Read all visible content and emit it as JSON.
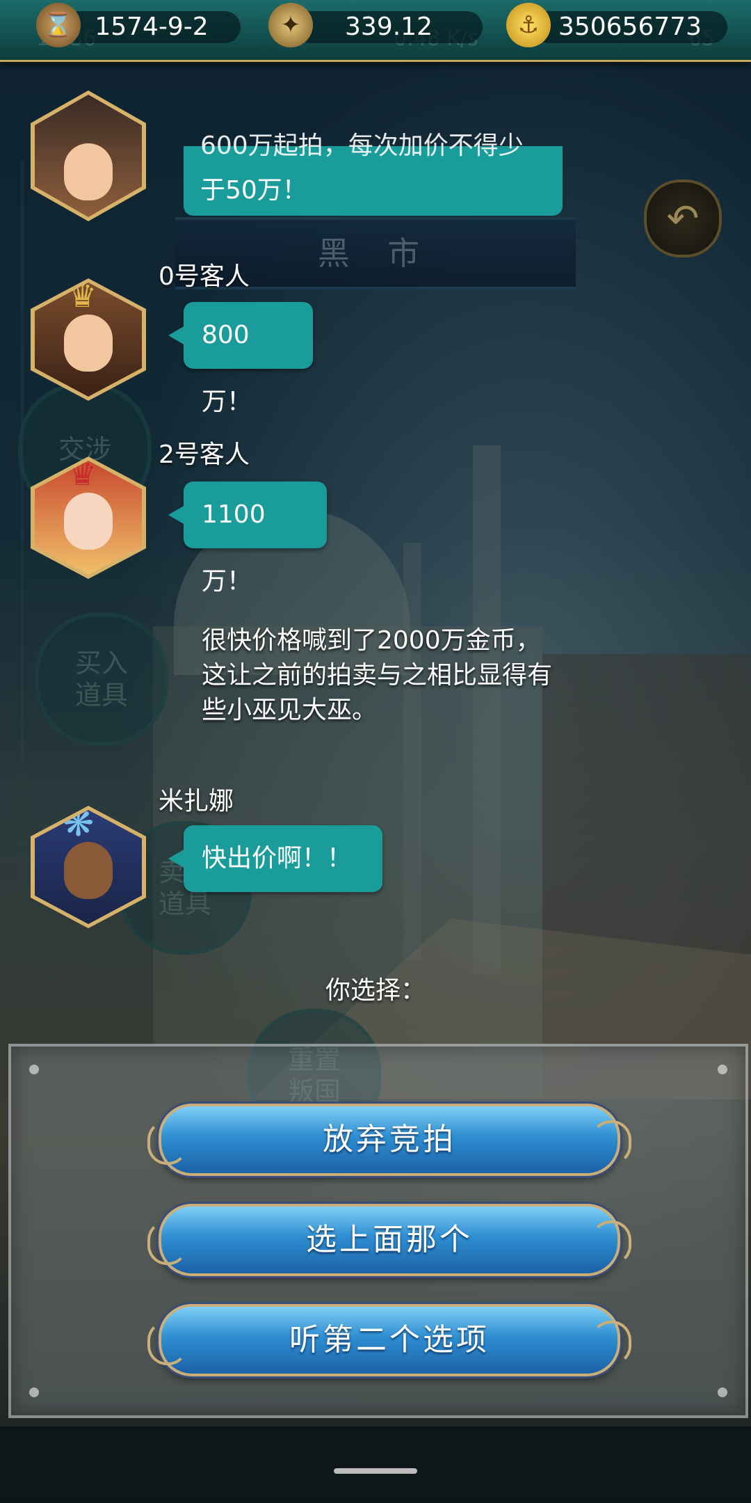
{
  "resources": {
    "date": "1574-9-2",
    "compass_value": "339.12",
    "gold": "350656773",
    "icons": [
      "hourglass-icon",
      "compass-icon",
      "anchor-coin-icon"
    ]
  },
  "status_overlay": {
    "time": "18:36",
    "net_speed": "0.48 K/s",
    "battery": "65"
  },
  "background": {
    "banner_title": "黑 市",
    "side_menu": [
      "交涉",
      "买入\n道具",
      "卖出\n道具",
      "重置\n叛国"
    ]
  },
  "chat": {
    "top_bubble": {
      "line1": "600万起拍，每次加价不得少",
      "line2": "于50万！"
    },
    "messages": [
      {
        "speaker": "0号客人",
        "text": "800万！",
        "avatar": "crowned-man-avatar"
      },
      {
        "speaker": "2号客人",
        "text": "1100万！",
        "avatar": "crowned-woman-avatar"
      },
      {
        "speaker": "米扎娜",
        "text": "快出价啊！！",
        "avatar": "feather-headdress-avatar"
      }
    ],
    "narration": "很快价格喊到了2000万金币，这让之前的拍卖与之相比显得有些小巫见大巫。"
  },
  "choice_prompt": "你选择：",
  "choices": [
    "放弃竞拍",
    "选上面那个",
    "听第二个选项"
  ],
  "colors": {
    "bubble": "#1a9c9b",
    "button_gold_frame": "#c9b07a",
    "button_blue": "#2f8ed1"
  }
}
